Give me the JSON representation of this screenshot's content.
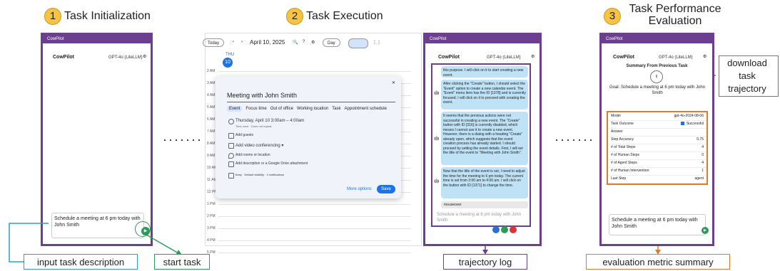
{
  "stages": {
    "s1": {
      "num": "1",
      "title": "Task Initialization"
    },
    "s2": {
      "num": "2",
      "title": "Task Execution"
    },
    "s3": {
      "num": "3",
      "title": "Task Performance\nEvaluation"
    }
  },
  "cowpilot": {
    "app": "CowPilot",
    "model": "GPT-4o (LiteLLM)"
  },
  "panel1": {
    "task_text": "Schedule a meeting at 6 pm today with John Smith"
  },
  "calendar": {
    "today_btn": "Today",
    "date": "April 10, 2025",
    "view": "Day",
    "day_label": "THU",
    "day_num": "10",
    "hours": [
      "2 AM",
      "3 AM",
      "4 AM",
      "5 AM",
      "6 AM",
      "7 AM",
      "8 AM",
      "9 AM",
      "10 AM",
      "11 AM",
      "12 PM",
      "1 PM",
      "2 PM",
      "3 PM",
      "4 PM",
      "5 PM"
    ],
    "dialog": {
      "title": "Meeting with John Smith",
      "tabs": [
        "Event",
        "Focus time",
        "Out of office",
        "Working location",
        "Task",
        "Appointment schedule"
      ],
      "datetime": "Thursday, April 10   3:00am  –  4:00am",
      "datetime_sub": "Time zone · Does not repeat",
      "add_guests": "Add guests",
      "video": "Add video conferencing",
      "location": "Add rooms or location",
      "description": "Add description or a Google Drive attachment",
      "busy": "Busy · Default visibility · 2 notifications",
      "more": "More options",
      "save": "Save"
    }
  },
  "panel2b": {
    "messages": [
      "this purpose. I will click on it to start creating a new event.",
      "After clicking the \"Create\" button, I should select the \"Event\" option to create a new calendar event. The \"Event\" menu item has the ID [1378] and is currently focused. I will click on it to proceed with creating the event.",
      "It seems that the previous actions were not successful in creating a new event. The \"Create\" button with ID [316] is currently disabled, which means I cannot use it to create a new event. However, there is a dialog with a heading \"Create\" already open, which suggests that the event creation process has already started. I should proceed by setting the event details. First, I will set the title of the event to \"Meeting with John Smith\".",
      "Now that the title of the event is set, I need to adjust the time for the meeting to 6 pm today. The current time is set from 3:00 am to 4:00 am. I will click on the button with ID [1371] to change the time."
    ],
    "action": "mouseover",
    "input_placeholder": "Schedule a meeting at 6 pm today with John Smith"
  },
  "panel3": {
    "summary_title": "Summary From Previous Task",
    "goal": "Goal: Schedule a meeting at 6 pm today with John Smith",
    "metrics": [
      {
        "k": "Model",
        "v": "gpt-4o-2024-08-06"
      },
      {
        "k": "Task Outcome",
        "v": "Successful"
      },
      {
        "k": "Answer",
        "v": ""
      },
      {
        "k": "Step Accuracy",
        "v": "0.75"
      },
      {
        "k": "# of Total Steps",
        "v": "4"
      },
      {
        "k": "# of Human Steps",
        "v": "0"
      },
      {
        "k": "# of Agent Steps",
        "v": "4"
      },
      {
        "k": "# of Human Intervention",
        "v": "1"
      },
      {
        "k": "Last Step",
        "v": "agent"
      }
    ],
    "task_text": "Schedule a meeting at 6 pm today with John Smith"
  },
  "callouts": {
    "input_task": "input task description",
    "start_task": "start task",
    "trajectory_log": "trajectory log",
    "eval_summary": "evaluation metric summary",
    "download": "download\ntask\ntrajectory"
  },
  "colors": {
    "purple": "#6b3f8e",
    "blue_callout": "#2a9fd6",
    "green_callout": "#2e9a5a",
    "orange_callout": "#e07b2a",
    "gray_callout": "#777777"
  }
}
